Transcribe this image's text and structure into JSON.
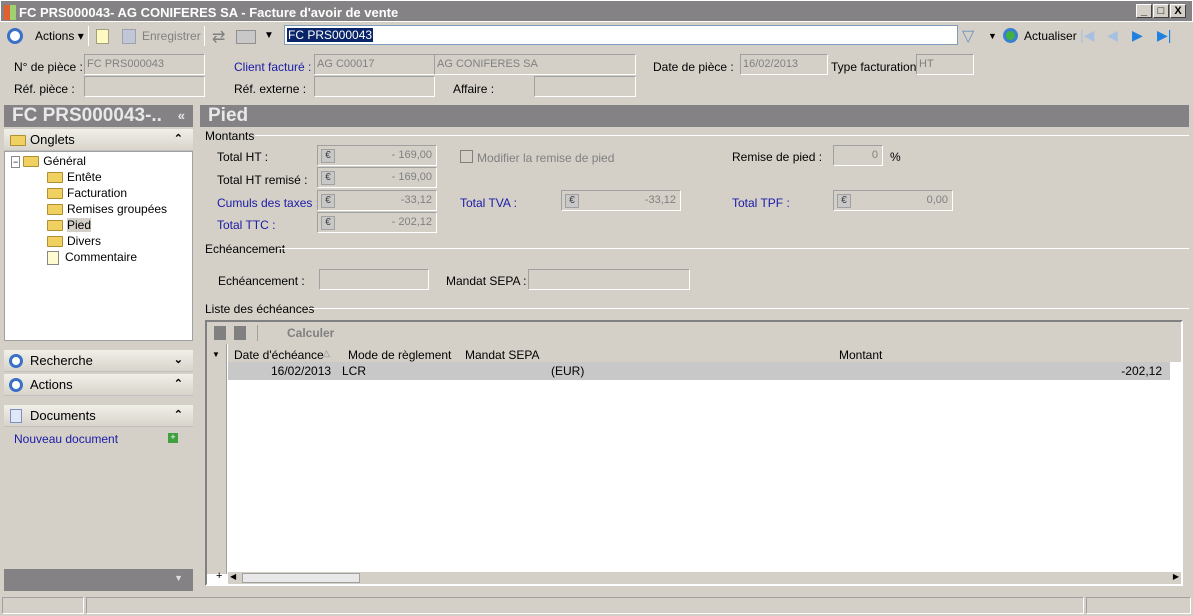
{
  "window": {
    "title": "FC PRS000043- AG CONIFERES SA -  Facture d'avoir de vente",
    "min": "_",
    "max": "□",
    "close": "X"
  },
  "toolbar": {
    "actions": "Actions",
    "save": "Enregistrer",
    "search_value": "FC PRS000043",
    "refresh": "Actualiser"
  },
  "header": {
    "num_piece_label": "N° de pièce :",
    "num_piece": "FC PRS000043",
    "ref_piece_label": "Réf. pièce :",
    "ref_piece": "",
    "client_label": "Client facturé :",
    "client_code": "AG C00017",
    "client_name": "AG CONIFERES SA",
    "ref_ext_label": "Réf. externe :",
    "affaire_label": "Affaire :",
    "date_label": "Date de  pièce :",
    "date": "16/02/2013",
    "type_label": "Type facturation :",
    "type": "HT"
  },
  "sidebar": {
    "title": "FC PRS000043-..",
    "collapse": "«",
    "onglets": "Onglets",
    "tree": [
      {
        "label": "Général"
      },
      {
        "label": "Entête"
      },
      {
        "label": "Facturation"
      },
      {
        "label": "Remises groupées"
      },
      {
        "label": "Pied"
      },
      {
        "label": "Divers"
      },
      {
        "label": "Commentaire"
      }
    ],
    "recherche": "Recherche",
    "actions": "Actions",
    "documents": "Documents",
    "new_doc": "Nouveau document"
  },
  "main": {
    "title": "Pied",
    "montants": "Montants",
    "total_ht_label": "Total HT :",
    "total_ht": "- 169,00",
    "total_ht_remise_label": "Total HT remisé :",
    "total_ht_remise": "- 169,00",
    "cumuls_label": "Cumuls des taxes :",
    "cumuls": "-33,12",
    "ttc_label": "Total TTC :",
    "ttc": "- 202,12",
    "modifier_remise": "Modifier la remise de pied",
    "tva_label": "Total TVA :",
    "tva": "-33,12",
    "remise_label": "Remise de pied :",
    "remise": "0",
    "pct": "%",
    "tpf_label": "Total TPF :",
    "tpf": "0,00",
    "echeancement_grp": "Echéancement",
    "echeancement_label": "Echéancement :",
    "mandat_label": "Mandat SEPA :",
    "liste": "Liste des échéances",
    "calculer": "Calculer",
    "columns": [
      "Date d'échéance",
      "Mode de règlement",
      "Mandat SEPA",
      "Montant"
    ],
    "rows": [
      {
        "date": "16/02/2013",
        "mode": "LCR",
        "mandat": "(EUR)",
        "montant": "-202,12"
      }
    ]
  }
}
